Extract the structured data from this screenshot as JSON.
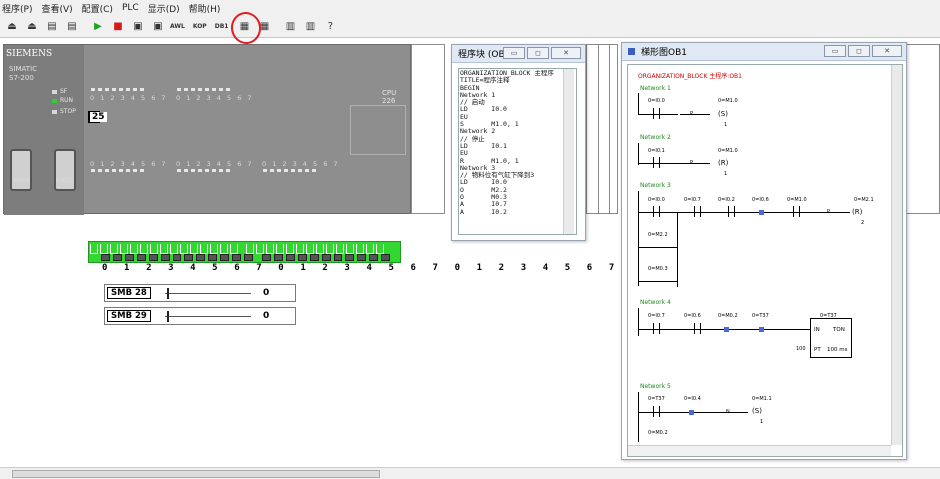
{
  "menu": [
    "程序(P)",
    "查看(V)",
    "配置(C)",
    "PLC",
    "显示(D)",
    "帮助(H)"
  ],
  "toolbar": {
    "awl": "AWL",
    "kop": "KOP",
    "db1": "DB1"
  },
  "plc": {
    "brand": "SIEMENS",
    "series": "SIMATIC",
    "model": "S7-200",
    "leds": [
      "SF",
      "RUN",
      "STOP"
    ],
    "cpu": "CPU 226",
    "display_value": "25",
    "io_numbers": "0 1 2 3 4 5 6 7",
    "ports": [
      "PORT0",
      "PORT1"
    ]
  },
  "switch_numbers": "0 1 2 3 4 5 6 7 0 1 2 3 4  5 6 7 0 1 2 3 4 5 6 7",
  "smb": [
    {
      "label": "SMB 28",
      "value": "0"
    },
    {
      "label": "SMB 29",
      "value": "0"
    }
  ],
  "program_window": {
    "title": "程序块 (OB1)",
    "code": "ORGANIZATION_BLOCK 主程序\nTITLE=程序注释\nBEGIN\nNetwork 1\n// 启动\nLD      I0.0\nEU\nS       M1.0, 1\nNetwork 2\n// 停止\nLD      I0.1\nEU\nR       M1.0, 1\nNetwork 3\n// 物料位有气缸下降到3\nLD      I0.0\nO       M2.2\nO       M0.3\nA       I0.7\nA       I0.2"
  },
  "ladder_window": {
    "title": "梯形图OB1",
    "header": "ORGANIZATION_BLOCK 主程序:OB1",
    "networks": [
      "Network 1",
      "Network 2",
      "Network 3",
      "Network 4",
      "Network 5"
    ],
    "labels": {
      "n1_c1": "0=I0.0",
      "n1_c2": "0=M1.0",
      "n1_p": "P",
      "n1_s": "S",
      "n1_one": "1",
      "n2_c1": "0=I0.1",
      "n2_c2": "0=M1.0",
      "n2_p": "P",
      "n2_r": "R",
      "n2_one": "1",
      "n3_c1": "0=I0.0",
      "n3_c2": "0=I0.7",
      "n3_c3": "0=I0.2",
      "n3_c4": "0=I0.6",
      "n3_c5": "0=M1.0",
      "n3_c6": "0=M2.1",
      "n3_p": "P",
      "n3_r": "R",
      "n3_two": "2",
      "n3_b1": "0=M2.2",
      "n3_b2": "0=M0.3",
      "n4_c1": "0=I0.7",
      "n4_c2": "0=I0.6",
      "n4_c3": "0=M0.2",
      "n4_c4": "0=T37",
      "n4_c5": "0=T37",
      "ton_in": "IN",
      "ton_name": "TON",
      "ton_pt": "PT",
      "ton_base": "100 ms",
      "ton_preset": "100",
      "n5_c1": "0=T37",
      "n5_c2": "0=I0.4",
      "n5_c3": "0=M1.1",
      "n5_n": "N",
      "n5_s": "S",
      "n5_one": "1",
      "n5_b1": "0=M0.2"
    }
  },
  "colors": {
    "accent_red": "#d00000",
    "network_green": "#1e8a1e",
    "switch_green": "#32d732",
    "contact_blue": "#4b6ad8"
  }
}
